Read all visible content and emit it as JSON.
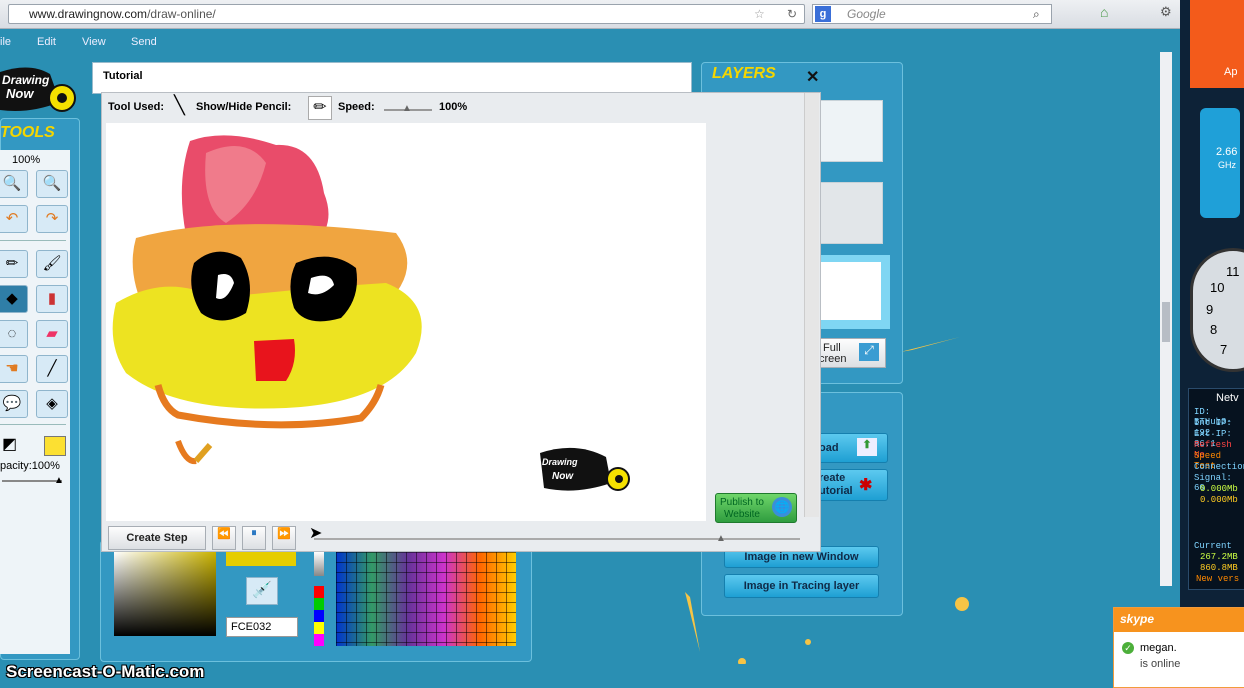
{
  "browser": {
    "url": "www.drawingnow.com/draw-online/",
    "url_host": "www.drawingnow.com",
    "url_path": "/draw-online/",
    "search_placeholder": "Google"
  },
  "menu": [
    "ile",
    "Edit",
    "View",
    "Send"
  ],
  "tools": {
    "title": "TOOLS",
    "zoom": "100%",
    "opacity": "pacity:100%"
  },
  "tutorial": {
    "title": "Tutorial",
    "tool_used_label": "Tool Used:",
    "show_hide_label": "Show/Hide Pencil:",
    "speed_label": "Speed:",
    "speed_value": "100%",
    "speed_fraction": 0.5,
    "create_step": "Create Step",
    "publish": "Publish to Website",
    "publish_line1": "Publish to",
    "publish_line2": "Website"
  },
  "layers": {
    "title": "LAYERS",
    "full_screen_1": "Full",
    "full_screen_2": "creen",
    "upload": "oad",
    "create_tutorial_1": "reate",
    "create_tutorial_2": "utorial",
    "image_new_window": "Image in new Window",
    "image_tracing": "Image in Tracing layer"
  },
  "colors": {
    "hex": "FCE032",
    "current": "#fce032"
  },
  "watermark": "Screencast-O-Matic.com",
  "skype": {
    "brand": "skype",
    "contact": "megan.",
    "status": "is online"
  },
  "desktop": {
    "cpu": "2.66",
    "cpu_unit": "GHz",
    "apps": "Ap",
    "net_title": "Netv",
    "net_lines": [
      "ID: BTHub3-",
      "Int IP: 192.",
      "Ext IP: 86.1",
      "Refresh Ne",
      "Speed Test",
      "Connection",
      "Signal: 60",
      "0.000Mb",
      "0.000Mb"
    ],
    "current_label": "Current",
    "usage_lines": [
      "267.2MB",
      "860.8MB",
      "New vers"
    ],
    "clock_numbers": [
      "10",
      "11",
      "9",
      "8",
      "7"
    ]
  }
}
